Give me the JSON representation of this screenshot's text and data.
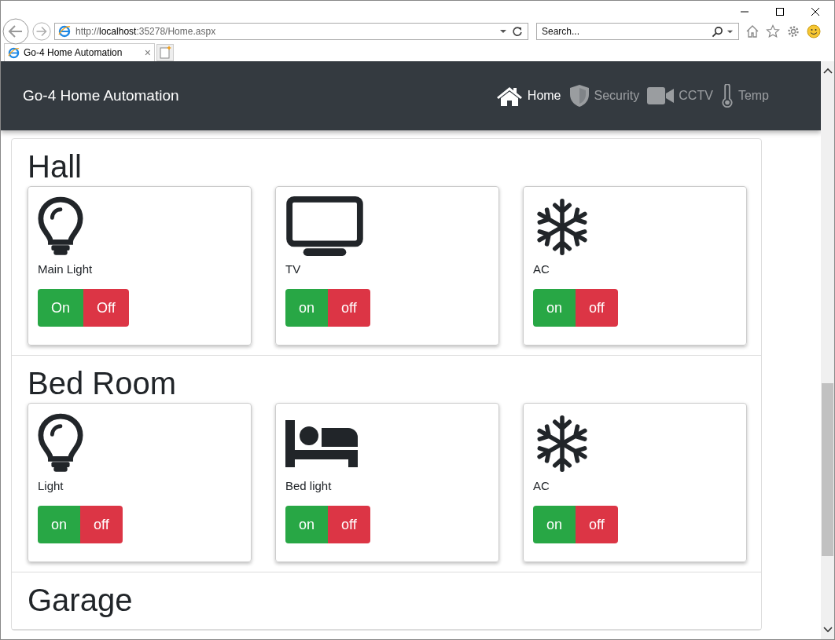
{
  "browser": {
    "address": "http://**localhost**:35278/Home.aspx",
    "search": {
      "placeholder": "Search..."
    },
    "tab": {
      "title": "Go-4 Home Automation",
      "close": "×"
    }
  },
  "navbar": {
    "brand": "Go-4 Home Automation",
    "items": [
      {
        "label": "Home",
        "kind": "house",
        "selected": true
      },
      {
        "label": "Security",
        "kind": "shield",
        "selected": false
      },
      {
        "label": "CCTV",
        "kind": "camera",
        "selected": false
      },
      {
        "label": "Temp",
        "kind": "thermometer",
        "selected": false
      }
    ]
  },
  "rooms": [
    {
      "name": "Hall",
      "devices": [
        {
          "kind": "bulb",
          "label": "Main Light",
          "on_label": "On",
          "off_label": "Off"
        },
        {
          "kind": "tv",
          "label": "TV",
          "on_label": "on",
          "off_label": "off"
        },
        {
          "kind": "snowflake",
          "label": "AC",
          "on_label": "on",
          "off_label": "off"
        }
      ]
    },
    {
      "name": "Bed Room",
      "devices": [
        {
          "kind": "bulb",
          "label": "Light",
          "on_label": "on",
          "off_label": "off"
        },
        {
          "kind": "bed",
          "label": "Bed light",
          "on_label": "on",
          "off_label": "off"
        },
        {
          "kind": "snowflake",
          "label": "AC",
          "on_label": "on",
          "off_label": "off"
        }
      ]
    },
    {
      "name": "Garage"
    }
  ]
}
